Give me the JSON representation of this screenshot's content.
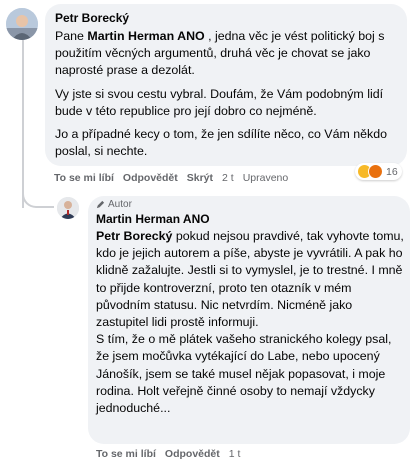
{
  "comment": {
    "author": "Petr Borecký",
    "paragraphs": [
      {
        "before": "Pane ",
        "mention": "Martin Herman ANO",
        "after": " , jedna věc je vést politický boj s použitím věcných argumentů, druhá věc je chovat se jako naprosté prase a dezolát."
      },
      {
        "text": "Vy jste si svou cestu vybral. Doufám, že Vám podobným lidí bude v této republice pro její dobro co nejméně."
      },
      {
        "text": "Jo a případné kecy o tom, že jen sdílíte něco, co Vám někdo poslal, si nechte."
      }
    ],
    "actions": {
      "like": "To se mi líbí",
      "reply": "Odpovědět",
      "hide": "Skrýt",
      "time": "2 t",
      "edited": "Upraveno"
    },
    "reactions": {
      "count": "16",
      "icons": [
        "laugh-reaction-icon",
        "angry-reaction-icon"
      ],
      "colors": {
        "laugh": "#f7b928",
        "angry": "#e9710f"
      }
    }
  },
  "reply": {
    "badge": "Autor",
    "author": "Martin Herman ANO",
    "mention": "Petr Borecký",
    "text_part1": " pokud nejsou pravdivé, tak vyhovte tomu, kdo je jejich autorem a píše, abyste je vyvrátili. A pak ho klidně zažalujte. Jestli si to vymyslel, je to trestné. I mně to přijde kontroverzní, proto ten otazník v mém původním statusu. Nic netvrdím. Nicméně jako zastupitel lidi prostě informuji.",
    "text_part2": "S tím, že o mě plátek vašeho stranického kolegy psal, že jsem močůvka vytékající do Labe, nebo upocený Jánošík, jsem se také musel nějak popasovat, i moje rodina. Holt veřejně činné osoby to nemají vždycky jednoduché...",
    "actions": {
      "like": "To se mi líbí",
      "reply": "Odpovědět",
      "time": "1 t"
    }
  },
  "colors": {
    "bubble": "#f0f2f5",
    "secondary_text": "#65676b",
    "thread_line": "#ced0d4"
  }
}
